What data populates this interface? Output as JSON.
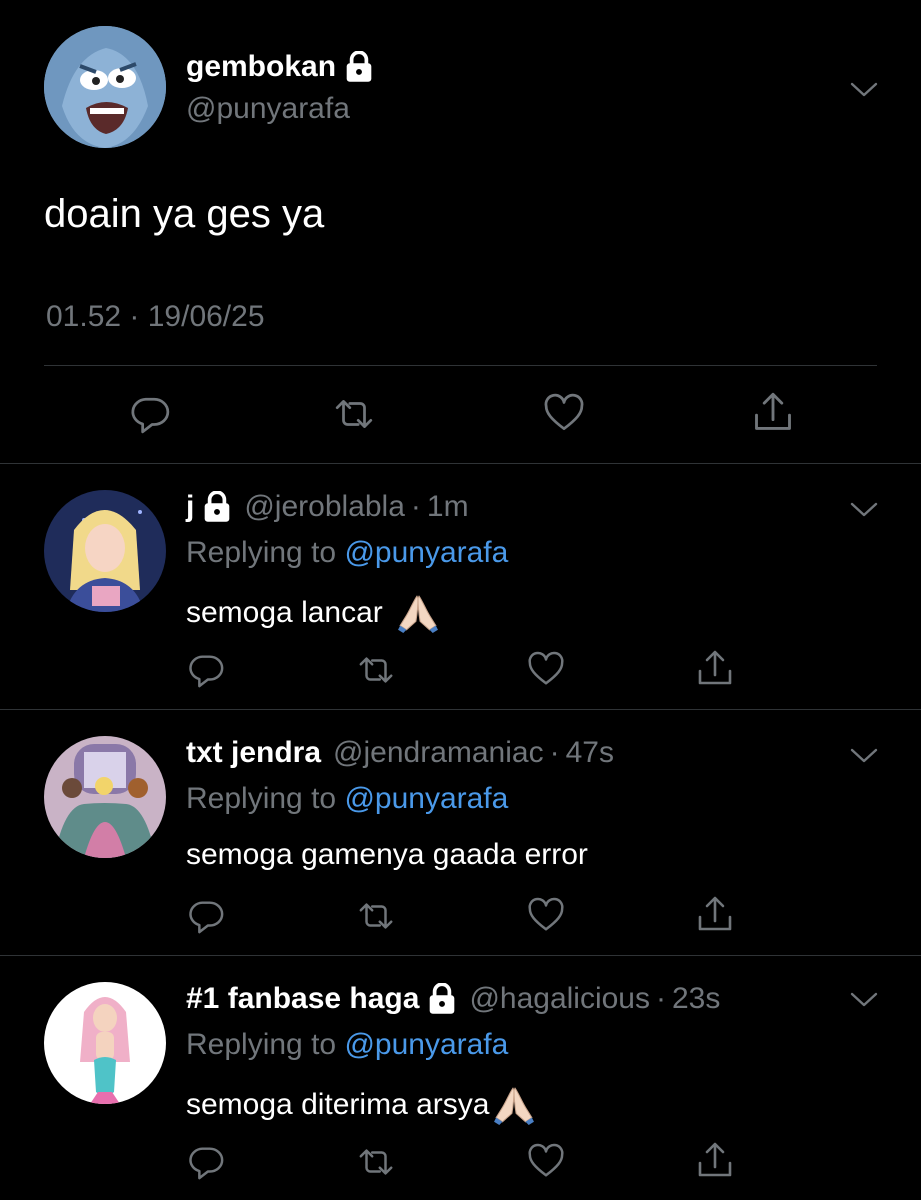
{
  "main": {
    "name": "gembokan",
    "handle": "@punyarafa",
    "text": "doain ya ges ya",
    "timestamp": "01.52 · 19/06/25"
  },
  "replies": [
    {
      "name": "j",
      "locked": true,
      "handle": "@jeroblabla",
      "sep": "·",
      "time": "1m",
      "replying_prefix": "Replying to ",
      "replying_to": "@punyarafa",
      "text": "semoga lancar",
      "emoji": "pray"
    },
    {
      "name": "txt jendra",
      "locked": false,
      "handle": "@jendramaniac",
      "sep": "·",
      "time": "47s",
      "replying_prefix": "Replying to ",
      "replying_to": "@punyarafa",
      "text": "semoga gamenya gaada error",
      "emoji": ""
    },
    {
      "name": "#1 fanbase haga",
      "locked": true,
      "handle": "@hagalicious",
      "sep": "·",
      "time": "23s",
      "replying_prefix": "Replying to ",
      "replying_to": "@punyarafa",
      "text": "semoga diterima arsya",
      "emoji": "pray"
    }
  ],
  "colors": {
    "background": "#000000",
    "secondary_text": "#71767b",
    "link": "#4a99e9",
    "divider": "#2f3336"
  },
  "icons": [
    "lock-icon",
    "chevron-down-icon",
    "reply-icon",
    "retweet-icon",
    "like-icon",
    "share-icon",
    "pray-emoji"
  ]
}
